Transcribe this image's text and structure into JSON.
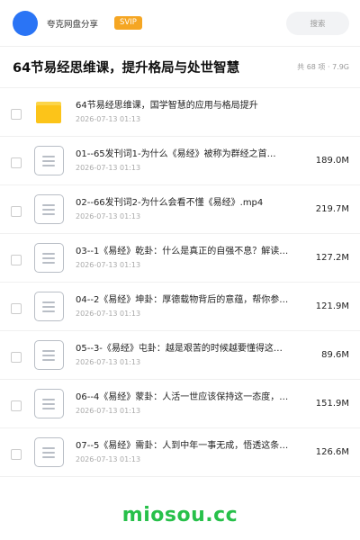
{
  "header": {
    "site_name": "夸克网盘分享",
    "badge": "SVIP",
    "search_placeholder": "搜索",
    "accent_color": "#2a74f5",
    "badge_color": "#f5a623"
  },
  "title_bar": {
    "title": "64节易经思维课，提升格局与处世智慧",
    "meta": "共 68 项 · 7.9G"
  },
  "files": [
    {
      "type": "folder",
      "icon": "folder-icon",
      "name": "64节易经思维课，国学智慧的应用与格局提升",
      "time": "2026-07-13 01:13",
      "size": ""
    },
    {
      "type": "file",
      "icon": "document-icon",
      "name": "01--65发刊词1-为什么《易经》被称为群经之首…",
      "time": "2026-07-13 01:13",
      "size": "189.0M"
    },
    {
      "type": "file",
      "icon": "document-icon",
      "name": "02--66发刊词2-为什么会看不懂《易经》.mp4",
      "time": "2026-07-13 01:13",
      "size": "219.7M"
    },
    {
      "type": "file",
      "icon": "document-icon",
      "name": "03--1《易经》乾卦：什么是真正的自强不息？解读…",
      "time": "2026-07-13 01:13",
      "size": "127.2M"
    },
    {
      "type": "file",
      "icon": "document-icon",
      "name": "04--2《易经》坤卦：厚德载物背后的意蕴，帮你参…",
      "time": "2026-07-13 01:13",
      "size": "121.9M"
    },
    {
      "type": "file",
      "icon": "document-icon",
      "name": "05--3-《易经》屯卦：越是艰苦的时候越要懂得这…",
      "time": "2026-07-13 01:13",
      "size": "89.6M"
    },
    {
      "type": "file",
      "icon": "document-icon",
      "name": "06--4《易经》蒙卦：人活一世应该保持这一态度，…",
      "time": "2026-07-13 01:13",
      "size": "151.9M"
    },
    {
      "type": "file",
      "icon": "document-icon",
      "name": "07--5《易经》需卦：人到中年一事无成，悟透这条…",
      "time": "2026-07-13 01:13",
      "size": "126.6M"
    }
  ],
  "watermark": "miosou.cc"
}
